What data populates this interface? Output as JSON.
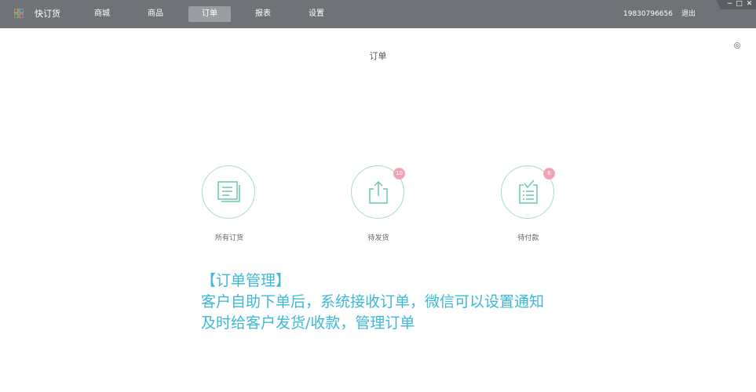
{
  "header": {
    "app_name": "快订货",
    "logo_icon": "grid-logo-icon",
    "nav": [
      {
        "label": "商城",
        "active": false
      },
      {
        "label": "商品",
        "active": false
      },
      {
        "label": "订单",
        "active": true
      },
      {
        "label": "报表",
        "active": false
      },
      {
        "label": "设置",
        "active": false
      }
    ],
    "phone": "19830796656",
    "logout": "退出",
    "window_controls": {
      "minimize": "−",
      "maximize": "□",
      "close": "✕"
    },
    "colors": {
      "background": "#6f7277",
      "active_tab": "#9a9da2"
    }
  },
  "main": {
    "title": "订单",
    "settings_icon": "gear-icon",
    "cards": [
      {
        "label": "所有订货",
        "icon": "document-stack-icon",
        "badge": null
      },
      {
        "label": "待发货",
        "icon": "share-upload-icon",
        "badge": "10"
      },
      {
        "label": "待付款",
        "icon": "checklist-icon",
        "badge": "6"
      }
    ],
    "colors": {
      "icon": "#6cc9a0",
      "badge": "#f2a4b6"
    }
  },
  "promo": {
    "line1": "【订单管理】",
    "line2": "客户自助下单后，系统接收订单，微信可以设置通知",
    "line3": "及时给客户发货/收款，管理订单",
    "color": "#3db8d8"
  }
}
